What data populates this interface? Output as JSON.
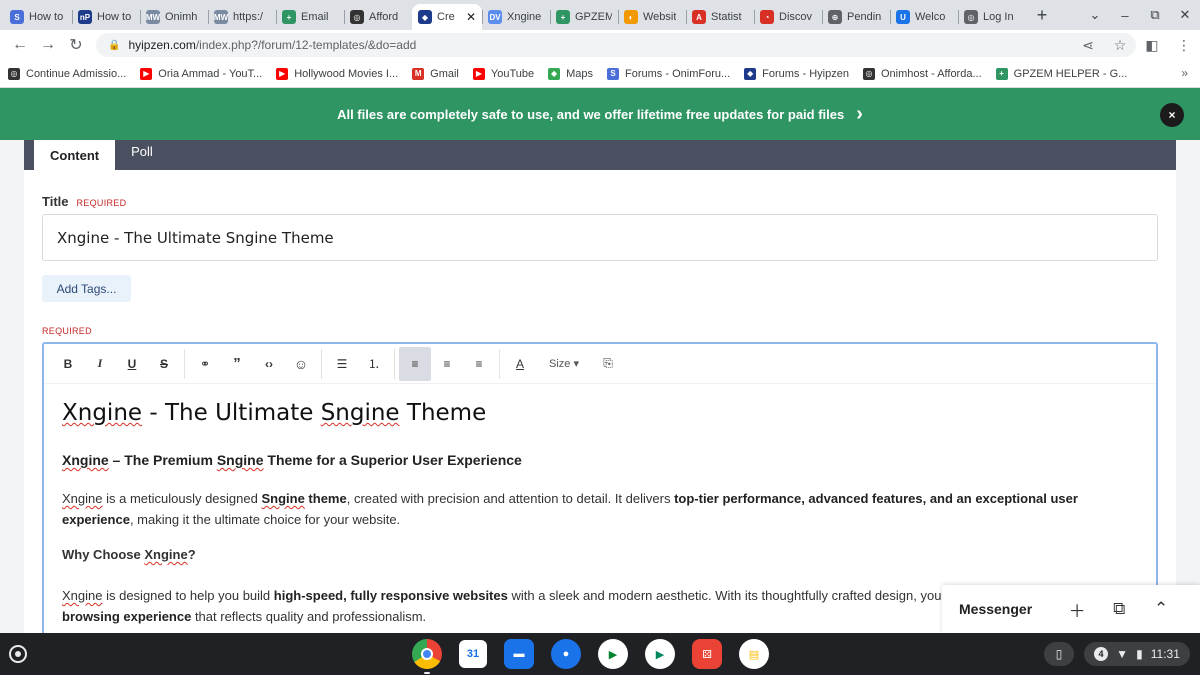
{
  "browser": {
    "tabs": [
      {
        "title": "How to",
        "icon": "onimhost-icon",
        "color": "#4a6fd8",
        "glyph": "S"
      },
      {
        "title": "How to",
        "icon": "np-icon",
        "color": "#1e3a8a",
        "glyph": "nP"
      },
      {
        "title": "Onimh",
        "icon": "mail-wizz-icon",
        "color": "#7a8aa0",
        "glyph": "MW"
      },
      {
        "title": "https:/",
        "icon": "mail-wizz-icon",
        "color": "#7a8aa0",
        "glyph": "MW"
      },
      {
        "title": "Email",
        "icon": "gpzem-icon",
        "color": "#2e9563",
        "glyph": "+"
      },
      {
        "title": "Afford",
        "icon": "onimhost-globe-icon",
        "color": "#333333",
        "glyph": "◎"
      },
      {
        "title": "Cre",
        "icon": "hyipzen-icon",
        "color": "#1e3a8a",
        "glyph": "◆",
        "active": true
      },
      {
        "title": "Xngine",
        "icon": "xngine-icon",
        "color": "#5a8dee",
        "glyph": "DV"
      },
      {
        "title": "GPZEM",
        "icon": "gpzem-icon",
        "color": "#2e9563",
        "glyph": "+"
      },
      {
        "title": "Websit",
        "icon": "website-icon",
        "color": "#f29900",
        "glyph": "◐"
      },
      {
        "title": "Statist",
        "icon": "statistics-icon",
        "color": "#d93025",
        "glyph": "A"
      },
      {
        "title": "Discov",
        "icon": "discover-icon",
        "color": "#d93025",
        "glyph": "◔"
      },
      {
        "title": "Pendin",
        "icon": "pending-globe-icon",
        "color": "#5f6368",
        "glyph": "⊕"
      },
      {
        "title": "Welco",
        "icon": "welcome-u-icon",
        "color": "#1a73e8",
        "glyph": "U"
      },
      {
        "title": "Log In",
        "icon": "login-globe-icon",
        "color": "#5f6368",
        "glyph": "◎"
      }
    ],
    "url_host": "hyipzen.com",
    "url_path": "/index.php?/forum/12-templates/&do=add",
    "bookmarks": [
      {
        "label": "Continue Admissio...",
        "color": "#333333",
        "glyph": "◎"
      },
      {
        "label": "Oria Ammad - YouT...",
        "color": "#ff0000",
        "glyph": "▶"
      },
      {
        "label": "Hollywood Movies I...",
        "color": "#ff0000",
        "glyph": "▶"
      },
      {
        "label": "Gmail",
        "color": "#d93025",
        "glyph": "M"
      },
      {
        "label": "YouTube",
        "color": "#ff0000",
        "glyph": "▶"
      },
      {
        "label": "Maps",
        "color": "#34a853",
        "glyph": "◆"
      },
      {
        "label": "Forums - OnimForu...",
        "color": "#4a6fd8",
        "glyph": "S"
      },
      {
        "label": "Forums - Hyipzen",
        "color": "#1e3a8a",
        "glyph": "◆"
      },
      {
        "label": "Onimhost - Afforda...",
        "color": "#333333",
        "glyph": "◎"
      },
      {
        "label": "GPZEM HELPER - G...",
        "color": "#2e9563",
        "glyph": "+"
      }
    ]
  },
  "banner": {
    "text": "All files are completely safe to use, and we offer lifetime free updates for paid files",
    "arrow": "›",
    "close": "×"
  },
  "form": {
    "tabs": [
      "Content",
      "Poll"
    ],
    "title_label": "Title",
    "required": "REQUIRED",
    "title_value": "Xngine - The Ultimate Sngine Theme",
    "tags_button": "Add Tags...",
    "size_label": "Size"
  },
  "editor": {
    "heading": [
      "Xngine",
      " - The Ultimate ",
      "Sngine",
      " Theme"
    ],
    "subheading": [
      "Xngine",
      " – The Premium ",
      "Sngine",
      " Theme for a Superior User Experience"
    ],
    "p1": [
      "Xngine",
      " is a meticulously designed ",
      "Sngine",
      " theme",
      ", created with precision and attention to detail. It delivers ",
      "top-tier performance, advanced features, and an exceptional user experience",
      ", making it the ultimate choice for your website."
    ],
    "why": [
      "Why Choose ",
      "Xngine",
      "?"
    ],
    "p2": [
      "Xngine",
      " is designed to help you build ",
      "high-speed, fully responsive websites",
      " with a sleek and modern aesthetic. With its thoughtfully crafted design, you",
      "browsing experience",
      " that reflects quality and professionalism."
    ]
  },
  "messenger": {
    "title": "Messenger"
  },
  "shelf": {
    "calendar_day": "31",
    "notif_count": "4",
    "time": "11:31"
  }
}
